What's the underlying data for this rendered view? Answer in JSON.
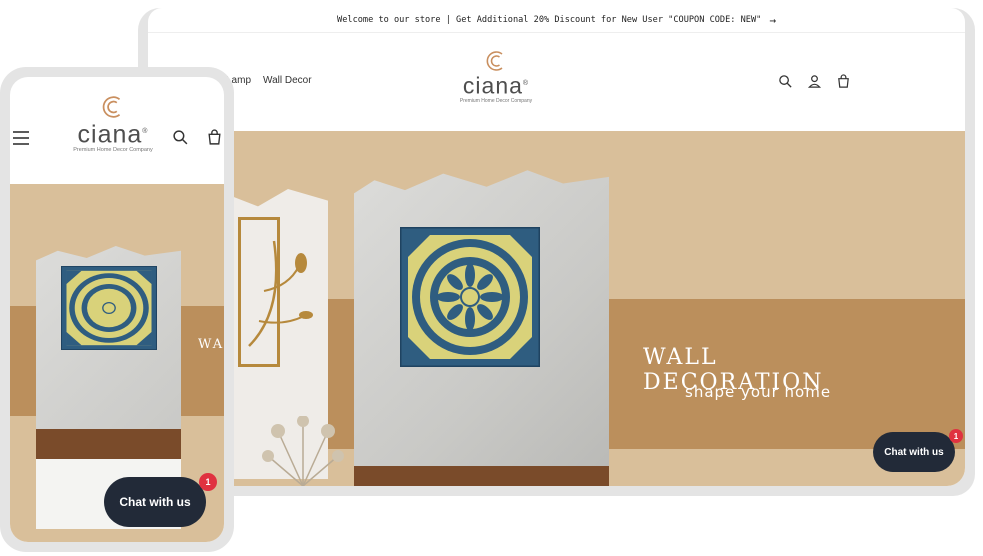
{
  "announcement": {
    "text": "Welcome to our store | Get Additional 20% Discount for New User \"COUPON CODE: NEW\"",
    "arrow": "→"
  },
  "desktop_nav": {
    "items": [
      {
        "label": "Lamp"
      },
      {
        "label": "Wall Decor"
      }
    ]
  },
  "brand": {
    "name": "ciana",
    "registered": "®",
    "tagline": "Premium Home Decor Company"
  },
  "header_icons": [
    "search-icon",
    "account-icon",
    "cart-icon"
  ],
  "hero": {
    "title": "WALL DECORATION",
    "subtitle": "shape your home",
    "mobile_title_fragment": "WAL"
  },
  "chat": {
    "label": "Chat with us",
    "badge": "1"
  },
  "colors": {
    "hero_bg": "#d9bf9a",
    "hero_band": "#bb8f5c",
    "chat_bg": "#222a38",
    "badge": "#e03240",
    "logo_accent": "#c98f5f",
    "mandala_blue": "#2f5d80",
    "mandala_gold": "#d9d27a"
  }
}
